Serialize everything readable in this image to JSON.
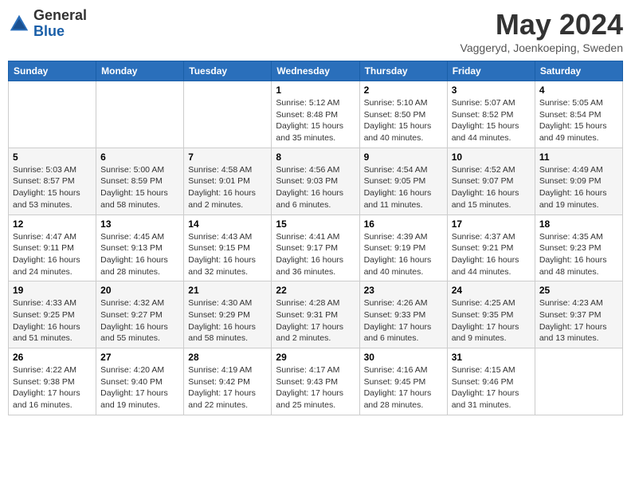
{
  "header": {
    "logo_general": "General",
    "logo_blue": "Blue",
    "month_title": "May 2024",
    "location": "Vaggeryd, Joenkoeping, Sweden"
  },
  "days_of_week": [
    "Sunday",
    "Monday",
    "Tuesday",
    "Wednesday",
    "Thursday",
    "Friday",
    "Saturday"
  ],
  "weeks": [
    [
      {
        "day": "",
        "info": ""
      },
      {
        "day": "",
        "info": ""
      },
      {
        "day": "",
        "info": ""
      },
      {
        "day": "1",
        "info": "Sunrise: 5:12 AM\nSunset: 8:48 PM\nDaylight: 15 hours and 35 minutes."
      },
      {
        "day": "2",
        "info": "Sunrise: 5:10 AM\nSunset: 8:50 PM\nDaylight: 15 hours and 40 minutes."
      },
      {
        "day": "3",
        "info": "Sunrise: 5:07 AM\nSunset: 8:52 PM\nDaylight: 15 hours and 44 minutes."
      },
      {
        "day": "4",
        "info": "Sunrise: 5:05 AM\nSunset: 8:54 PM\nDaylight: 15 hours and 49 minutes."
      }
    ],
    [
      {
        "day": "5",
        "info": "Sunrise: 5:03 AM\nSunset: 8:57 PM\nDaylight: 15 hours and 53 minutes."
      },
      {
        "day": "6",
        "info": "Sunrise: 5:00 AM\nSunset: 8:59 PM\nDaylight: 15 hours and 58 minutes."
      },
      {
        "day": "7",
        "info": "Sunrise: 4:58 AM\nSunset: 9:01 PM\nDaylight: 16 hours and 2 minutes."
      },
      {
        "day": "8",
        "info": "Sunrise: 4:56 AM\nSunset: 9:03 PM\nDaylight: 16 hours and 6 minutes."
      },
      {
        "day": "9",
        "info": "Sunrise: 4:54 AM\nSunset: 9:05 PM\nDaylight: 16 hours and 11 minutes."
      },
      {
        "day": "10",
        "info": "Sunrise: 4:52 AM\nSunset: 9:07 PM\nDaylight: 16 hours and 15 minutes."
      },
      {
        "day": "11",
        "info": "Sunrise: 4:49 AM\nSunset: 9:09 PM\nDaylight: 16 hours and 19 minutes."
      }
    ],
    [
      {
        "day": "12",
        "info": "Sunrise: 4:47 AM\nSunset: 9:11 PM\nDaylight: 16 hours and 24 minutes."
      },
      {
        "day": "13",
        "info": "Sunrise: 4:45 AM\nSunset: 9:13 PM\nDaylight: 16 hours and 28 minutes."
      },
      {
        "day": "14",
        "info": "Sunrise: 4:43 AM\nSunset: 9:15 PM\nDaylight: 16 hours and 32 minutes."
      },
      {
        "day": "15",
        "info": "Sunrise: 4:41 AM\nSunset: 9:17 PM\nDaylight: 16 hours and 36 minutes."
      },
      {
        "day": "16",
        "info": "Sunrise: 4:39 AM\nSunset: 9:19 PM\nDaylight: 16 hours and 40 minutes."
      },
      {
        "day": "17",
        "info": "Sunrise: 4:37 AM\nSunset: 9:21 PM\nDaylight: 16 hours and 44 minutes."
      },
      {
        "day": "18",
        "info": "Sunrise: 4:35 AM\nSunset: 9:23 PM\nDaylight: 16 hours and 48 minutes."
      }
    ],
    [
      {
        "day": "19",
        "info": "Sunrise: 4:33 AM\nSunset: 9:25 PM\nDaylight: 16 hours and 51 minutes."
      },
      {
        "day": "20",
        "info": "Sunrise: 4:32 AM\nSunset: 9:27 PM\nDaylight: 16 hours and 55 minutes."
      },
      {
        "day": "21",
        "info": "Sunrise: 4:30 AM\nSunset: 9:29 PM\nDaylight: 16 hours and 58 minutes."
      },
      {
        "day": "22",
        "info": "Sunrise: 4:28 AM\nSunset: 9:31 PM\nDaylight: 17 hours and 2 minutes."
      },
      {
        "day": "23",
        "info": "Sunrise: 4:26 AM\nSunset: 9:33 PM\nDaylight: 17 hours and 6 minutes."
      },
      {
        "day": "24",
        "info": "Sunrise: 4:25 AM\nSunset: 9:35 PM\nDaylight: 17 hours and 9 minutes."
      },
      {
        "day": "25",
        "info": "Sunrise: 4:23 AM\nSunset: 9:37 PM\nDaylight: 17 hours and 13 minutes."
      }
    ],
    [
      {
        "day": "26",
        "info": "Sunrise: 4:22 AM\nSunset: 9:38 PM\nDaylight: 17 hours and 16 minutes."
      },
      {
        "day": "27",
        "info": "Sunrise: 4:20 AM\nSunset: 9:40 PM\nDaylight: 17 hours and 19 minutes."
      },
      {
        "day": "28",
        "info": "Sunrise: 4:19 AM\nSunset: 9:42 PM\nDaylight: 17 hours and 22 minutes."
      },
      {
        "day": "29",
        "info": "Sunrise: 4:17 AM\nSunset: 9:43 PM\nDaylight: 17 hours and 25 minutes."
      },
      {
        "day": "30",
        "info": "Sunrise: 4:16 AM\nSunset: 9:45 PM\nDaylight: 17 hours and 28 minutes."
      },
      {
        "day": "31",
        "info": "Sunrise: 4:15 AM\nSunset: 9:46 PM\nDaylight: 17 hours and 31 minutes."
      },
      {
        "day": "",
        "info": ""
      }
    ]
  ]
}
